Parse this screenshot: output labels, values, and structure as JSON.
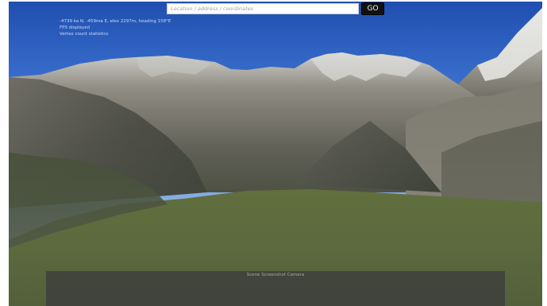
{
  "search": {
    "placeholder": "Location / address / coordinates",
    "value": "",
    "go_label": "GO"
  },
  "status": {
    "line1": "-4739 ka N, -459ma E, elev 2297m, heading 158°E",
    "line2": "FPS displayed",
    "line3": "Vertex count statistics"
  },
  "panel": {
    "title": "Scene Screenshot Camera"
  },
  "colors": {
    "sky_top": "#1f4fb0",
    "sky_horizon": "#c9d7e6",
    "grass": "#4f5f2c",
    "rock": "#6d6b63",
    "snow": "#d6d6d2",
    "panel": "#3c3c3c"
  }
}
